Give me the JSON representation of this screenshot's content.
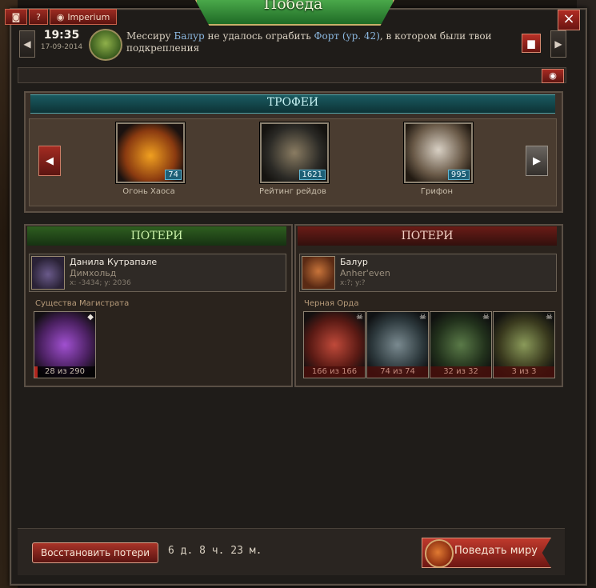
{
  "window": {
    "title": "Победа",
    "close": "×"
  },
  "toolbar": {
    "camera_icon": "camera-icon",
    "help": "?",
    "server_label": "Imperium"
  },
  "message": {
    "time": "19:35",
    "date": "17-09-2014",
    "part1": "Мессиру ",
    "name1": "Балур",
    "part2": " не удалось ограбить ",
    "name2": "Форт (ур. 42)",
    "part3": ", в котором были твои подкрепления"
  },
  "trophies": {
    "title": "ТРОФЕИ",
    "items": [
      {
        "label": "Огонь Хаоса",
        "count": "74"
      },
      {
        "label": "Рейтинг рейдов",
        "count": "1621"
      },
      {
        "label": "Грифон",
        "count": "995"
      }
    ]
  },
  "losses_left": {
    "title": "ПОТЕРИ",
    "player": {
      "name": "Данила Кутрапале",
      "guild": "Димхольд",
      "coords": "x: -3434; y: 2036"
    },
    "section": "Существа Магистрата",
    "units": [
      {
        "label": "28 из 290",
        "fraction": 0.0966
      }
    ]
  },
  "losses_right": {
    "title": "ПОТЕРИ",
    "player": {
      "name": "Балур",
      "guild": "Anher'even",
      "coords": "x:?; y:?"
    },
    "section": "Черная Орда",
    "units": [
      {
        "label": "166 из 166",
        "fraction": 1.0
      },
      {
        "label": "74 из 74",
        "fraction": 1.0
      },
      {
        "label": "32 из 32",
        "fraction": 1.0
      },
      {
        "label": "3 из 3",
        "fraction": 1.0
      }
    ]
  },
  "bottom": {
    "restore": "Восстановить потери",
    "timer": "6 д. 8 ч. 23 м.",
    "share": "Поведать миру"
  },
  "colors": {
    "accent_red": "#a32b22",
    "trophy_teal": "#1a5a60",
    "loss_green": "#2f5e20",
    "loss_red": "#6a1c17"
  }
}
